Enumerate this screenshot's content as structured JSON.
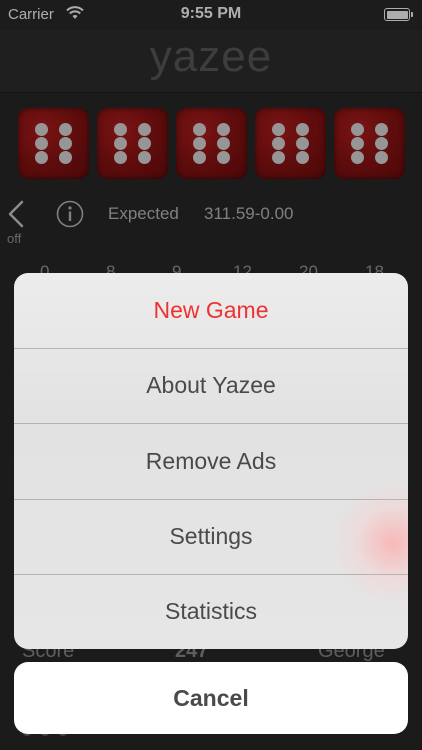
{
  "status_bar": {
    "carrier": "Carrier",
    "time": "9:55 PM"
  },
  "app": {
    "title": "yazee"
  },
  "dice": [
    6,
    6,
    6,
    6,
    6
  ],
  "game": {
    "off_label": "off",
    "expected_label": "Expected",
    "expected_value": "311.59-0.00",
    "score_numbers": [
      "0",
      "8",
      "9",
      "12",
      "20",
      "18"
    ],
    "bottom_left": "Score",
    "bottom_mid": "247",
    "bottom_right": "George"
  },
  "action_sheet": {
    "items": [
      {
        "label": "New Game",
        "color": "#ef3131"
      },
      {
        "label": "About Yazee"
      },
      {
        "label": "Remove Ads"
      },
      {
        "label": "Settings"
      },
      {
        "label": "Statistics"
      }
    ],
    "cancel_label": "Cancel"
  },
  "colors": {
    "accent_red": "#ef3131",
    "die_red": "#8a1212"
  }
}
